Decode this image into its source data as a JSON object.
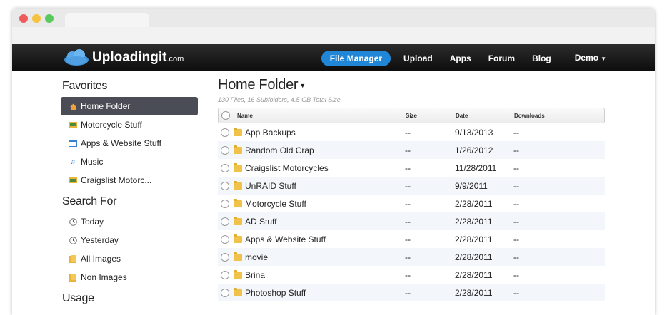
{
  "brand": {
    "name": "Uploadingit",
    "suffix": ".com"
  },
  "nav": {
    "items": [
      {
        "label": "File Manager",
        "active": true
      },
      {
        "label": "Upload"
      },
      {
        "label": "Apps"
      },
      {
        "label": "Forum"
      },
      {
        "label": "Blog"
      }
    ],
    "account": "Demo"
  },
  "sidebar": {
    "favorites_heading": "Favorites",
    "favorites": [
      {
        "label": "Home Folder",
        "icon": "home-icon"
      },
      {
        "label": "Motorcycle Stuff",
        "icon": "image-folder-icon"
      },
      {
        "label": "Apps & Website Stuff",
        "icon": "window-icon"
      },
      {
        "label": "Music",
        "icon": "music-icon"
      },
      {
        "label": "Craigslist Motorc...",
        "icon": "image-folder-icon"
      }
    ],
    "search_heading": "Search For",
    "search": [
      {
        "label": "Today",
        "icon": "clock-icon"
      },
      {
        "label": "Yesterday",
        "icon": "clock-icon"
      },
      {
        "label": "All Images",
        "icon": "folder-icon"
      },
      {
        "label": "Non Images",
        "icon": "folder-icon"
      }
    ],
    "usage_heading": "Usage"
  },
  "main": {
    "title": "Home Folder",
    "meta": "130 Files, 16 Subfolders, 4.5 GB Total Size",
    "columns": {
      "name": "Name",
      "size": "Size",
      "date": "Date",
      "downloads": "Downloads"
    },
    "rows": [
      {
        "name": "App Backups",
        "size": "--",
        "date": "9/13/2013",
        "downloads": "--"
      },
      {
        "name": "Random Old Crap",
        "size": "--",
        "date": "1/26/2012",
        "downloads": "--"
      },
      {
        "name": "Craigslist Motorcycles",
        "size": "--",
        "date": "11/28/2011",
        "downloads": "--"
      },
      {
        "name": "UnRAID Stuff",
        "size": "--",
        "date": "9/9/2011",
        "downloads": "--"
      },
      {
        "name": "Motorcycle Stuff",
        "size": "--",
        "date": "2/28/2011",
        "downloads": "--"
      },
      {
        "name": "AD Stuff",
        "size": "--",
        "date": "2/28/2011",
        "downloads": "--"
      },
      {
        "name": "Apps & Website Stuff",
        "size": "--",
        "date": "2/28/2011",
        "downloads": "--"
      },
      {
        "name": "movie",
        "size": "--",
        "date": "2/28/2011",
        "downloads": "--"
      },
      {
        "name": "Brina",
        "size": "--",
        "date": "2/28/2011",
        "downloads": "--"
      },
      {
        "name": "Photoshop Stuff",
        "size": "--",
        "date": "2/28/2011",
        "downloads": "--"
      }
    ]
  },
  "colors": {
    "accent": "#1f86d8",
    "navbar": "#1a1a1a",
    "selected": "#4a4d55",
    "folder": "#f0c24a"
  }
}
